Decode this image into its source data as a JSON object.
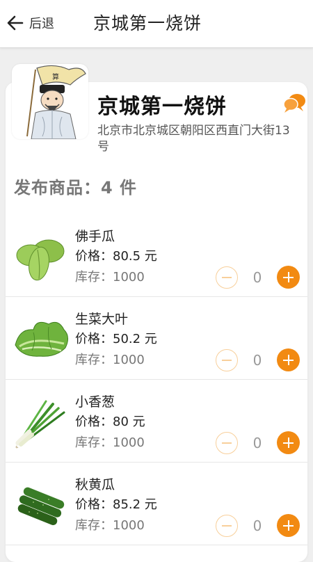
{
  "header": {
    "back_label": "后退",
    "title": "京城第一烧饼"
  },
  "shop": {
    "name": "京城第一烧饼",
    "address": "北京市北京城区朝阳区西直门大街13号",
    "avatar_icon": "cartoon-scholar-avatar",
    "chat_icon": "chat-bubbles-icon"
  },
  "products_title": "发布商品：4 件",
  "products": [
    {
      "name": "佛手瓜",
      "price": "价格：80.5 元",
      "stock": "库存：1000",
      "qty": "0",
      "icon": "chayote-image"
    },
    {
      "name": "生菜大叶",
      "price": "价格：50.2 元",
      "stock": "库存：1000",
      "qty": "0",
      "icon": "lettuce-image"
    },
    {
      "name": "小香葱",
      "price": "价格：80 元",
      "stock": "库存：1000",
      "qty": "0",
      "icon": "scallion-image"
    },
    {
      "name": "秋黄瓜",
      "price": "价格：85.2 元",
      "stock": "库存：1000",
      "qty": "0",
      "icon": "cucumber-image"
    }
  ],
  "colors": {
    "accent": "#f28a12",
    "minus_border": "#f8cf9a"
  }
}
